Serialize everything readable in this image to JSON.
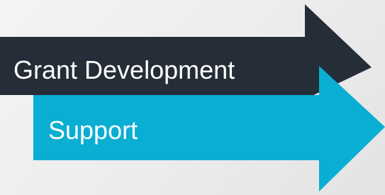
{
  "arrows": [
    {
      "label": "Grant Development",
      "color": "#252d38",
      "direction": "right"
    },
    {
      "label": "Support",
      "color": "#0aaed3",
      "direction": "right"
    }
  ]
}
